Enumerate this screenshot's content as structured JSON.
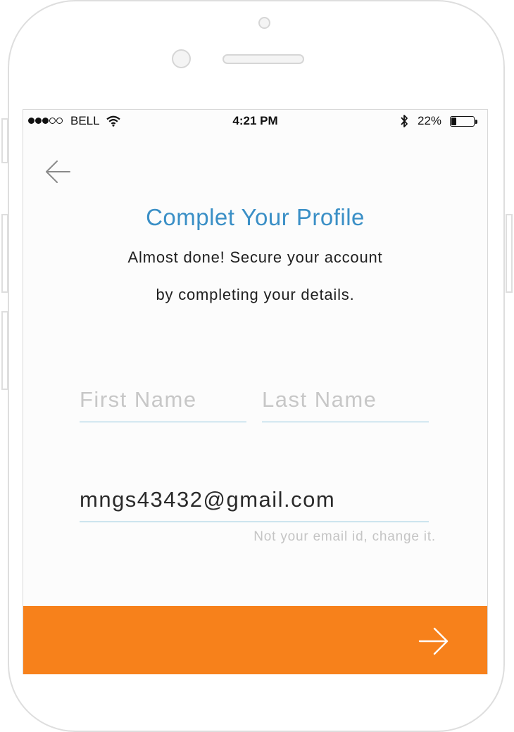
{
  "status_bar": {
    "carrier": "BELL",
    "time": "4:21 PM",
    "battery_percent_label": "22%",
    "battery_level": 0.22,
    "signal_bars_filled": 3,
    "signal_bars_total": 5
  },
  "header": {
    "back_icon": "arrow-left-icon",
    "title": "Complet Your Profile",
    "subtitle_line1": "Almost done! Secure your account",
    "subtitle_line2": "by completing your details."
  },
  "form": {
    "first_name": {
      "value": "",
      "placeholder": "First Name"
    },
    "last_name": {
      "value": "",
      "placeholder": "Last Name"
    },
    "email": {
      "value": "mngs43432@gmail.com",
      "placeholder": ""
    },
    "change_email_link": "Not your email id, change it."
  },
  "footer": {
    "next_icon": "arrow-right-icon",
    "accent_color": "#f7811b"
  },
  "colors": {
    "title": "#3a8fc6",
    "underline": "#8cc4dc"
  }
}
